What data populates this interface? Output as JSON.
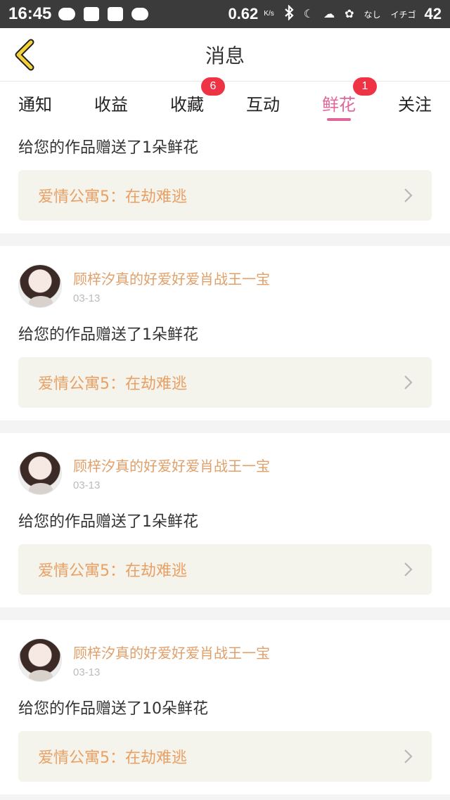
{
  "status_bar": {
    "time": "16:45",
    "net_speed": "0.62",
    "net_unit": "K/s",
    "moon_glyph": "☾",
    "cloud_glyph": "☁",
    "flower_glyph": "✿",
    "small_text_1": "なし",
    "small_text_2": "イチゴ",
    "battery": "42"
  },
  "nav": {
    "title": "消息"
  },
  "tabs": [
    {
      "label": "通知"
    },
    {
      "label": "收益"
    },
    {
      "label": "收藏",
      "badge": "6"
    },
    {
      "label": "互动"
    },
    {
      "label": "鲜花",
      "badge": "1",
      "active": true
    },
    {
      "label": "关注"
    }
  ],
  "messages": [
    {
      "text": "给您的作品赠送了1朵鲜花",
      "work": "爱情公寓5：在劫难逃"
    },
    {
      "user": "顾梓汐真的好爱好爱肖战王一宝",
      "date": "03-13",
      "text": "给您的作品赠送了1朵鲜花",
      "work": "爱情公寓5：在劫难逃"
    },
    {
      "user": "顾梓汐真的好爱好爱肖战王一宝",
      "date": "03-13",
      "text": "给您的作品赠送了1朵鲜花",
      "work": "爱情公寓5：在劫难逃"
    },
    {
      "user": "顾梓汐真的好爱好爱肖战王一宝",
      "date": "03-13",
      "text": "给您的作品赠送了10朵鲜花",
      "work": "爱情公寓5：在劫难逃"
    }
  ],
  "colors": {
    "accent": "#e0669a",
    "badge": "#ee3344",
    "username": "#e1a06a",
    "work_title": "#e9a064",
    "work_bg": "#f4f4ec",
    "back_arrow": "#f2d13b"
  }
}
